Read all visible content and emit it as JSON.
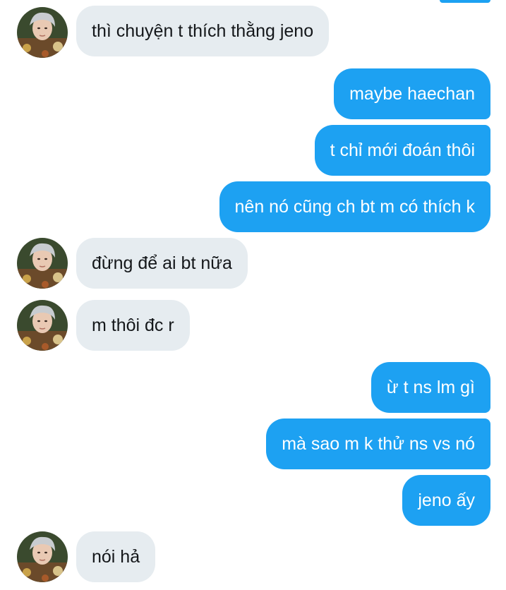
{
  "conversation": {
    "messages": [
      {
        "sender": "other",
        "text": "thì chuyện t thích thằng jeno"
      },
      {
        "sender": "me",
        "text": "maybe haechan"
      },
      {
        "sender": "me",
        "text": "t chỉ mới đoán thôi"
      },
      {
        "sender": "me",
        "text": "nên nó cũng ch bt m có thích k"
      },
      {
        "sender": "other",
        "text": "đừng để ai bt nữa"
      },
      {
        "sender": "other",
        "text": "m thôi đc r"
      },
      {
        "sender": "me",
        "text": "ừ t ns lm gì"
      },
      {
        "sender": "me",
        "text": "mà sao m k thử ns vs nó"
      },
      {
        "sender": "me",
        "text": "jeno ấy"
      },
      {
        "sender": "other",
        "text": "nói hả"
      }
    ]
  },
  "colors": {
    "incoming_bubble": "#e6ecf0",
    "outgoing_bubble": "#1da1f2",
    "incoming_text": "#14171a",
    "outgoing_text": "#ffffff"
  },
  "icons": {
    "avatar": "profile-photo"
  }
}
